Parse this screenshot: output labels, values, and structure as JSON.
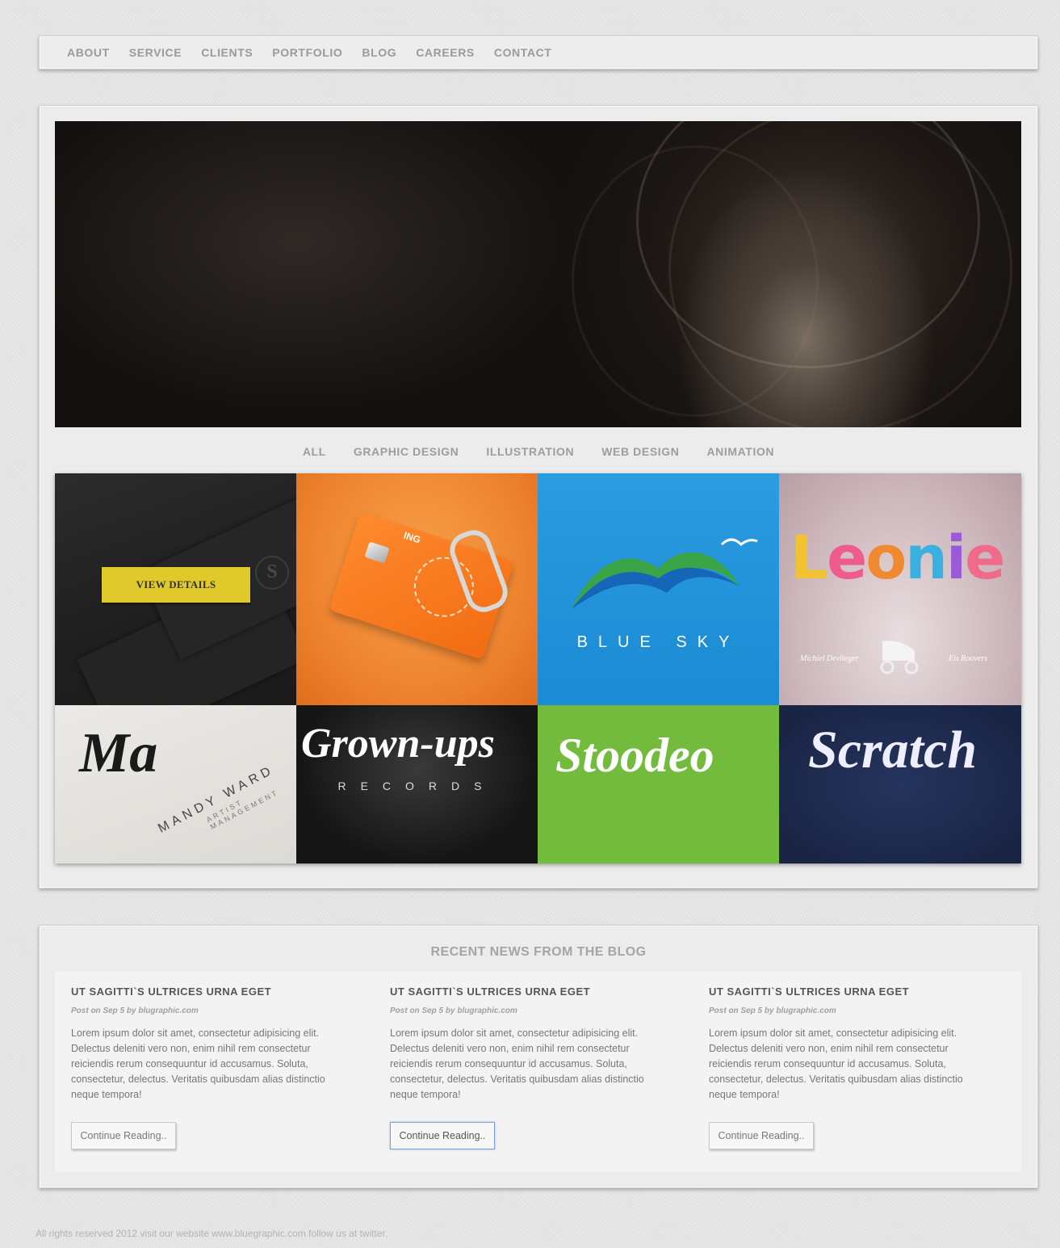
{
  "nav": {
    "items": [
      "ABOUT",
      "SERVICE",
      "CLIENTS",
      "PORTFOLIO",
      "BLOG",
      "CAREERS",
      "CONTACT"
    ]
  },
  "filters": {
    "items": [
      "ALL",
      "GRAPHIC DESIGN",
      "ILLUSTRATION",
      "WEB DESIGN",
      "ANIMATION"
    ]
  },
  "portfolio": {
    "view_details_label": "VIEW DETAILS",
    "tiles": {
      "card_ing": "ING",
      "blue_sky": "BLUE SKY",
      "leonie": "Leonie",
      "leonie_left": "Michiel Devlieger",
      "leonie_right": "Els Roovers",
      "mandy": "Ma",
      "mandy_name": "MANDY WARD",
      "mandy_sub": "ARTIST MANAGEMENT",
      "records_script": "Grown-ups",
      "records": "RECORDS",
      "green_script": "Stoodeo",
      "navy_script": "Scratch"
    }
  },
  "blog": {
    "title": "RECENT NEWS FROM THE BLOG",
    "posts": [
      {
        "title": "UT SAGITTI`S ULTRICES URNA EGET",
        "meta": "Post on Sep 5 by blugraphic.com",
        "body": "Lorem ipsum dolor sit amet, consectetur adipisicing elit. Delectus deleniti vero non, enim nihil rem consectetur reiciendis rerum consequuntur id accusamus. Soluta, consectetur, delectus. Veritatis quibusdam alias distinctio neque tempora!",
        "button": "Continue Reading.."
      },
      {
        "title": "UT SAGITTI`S ULTRICES URNA EGET",
        "meta": "Post on Sep 5 by blugraphic.com",
        "body": "Lorem ipsum dolor sit amet, consectetur adipisicing elit. Delectus deleniti vero non, enim nihil rem consectetur reiciendis rerum consequuntur id accusamus. Soluta, consectetur, delectus. Veritatis quibusdam alias distinctio neque tempora!",
        "button": "Continue Reading.."
      },
      {
        "title": "UT SAGITTI`S ULTRICES URNA EGET",
        "meta": "Post on Sep 5 by blugraphic.com",
        "body": "Lorem ipsum dolor sit amet, consectetur adipisicing elit. Delectus deleniti vero non, enim nihil rem consectetur reiciendis rerum consequuntur id accusamus. Soluta, consectetur, delectus. Veritatis quibusdam alias distinctio neque tempora!",
        "button": "Continue Reading.."
      }
    ]
  },
  "footer": {
    "text": "All rights reserved 2012 visit our website www.bluegraphic.com follow us at twitter."
  },
  "colors": {
    "accent_yellow": "#e0c92a",
    "nav_text": "#9a9a9a",
    "focus_border": "#7e9fd8"
  }
}
